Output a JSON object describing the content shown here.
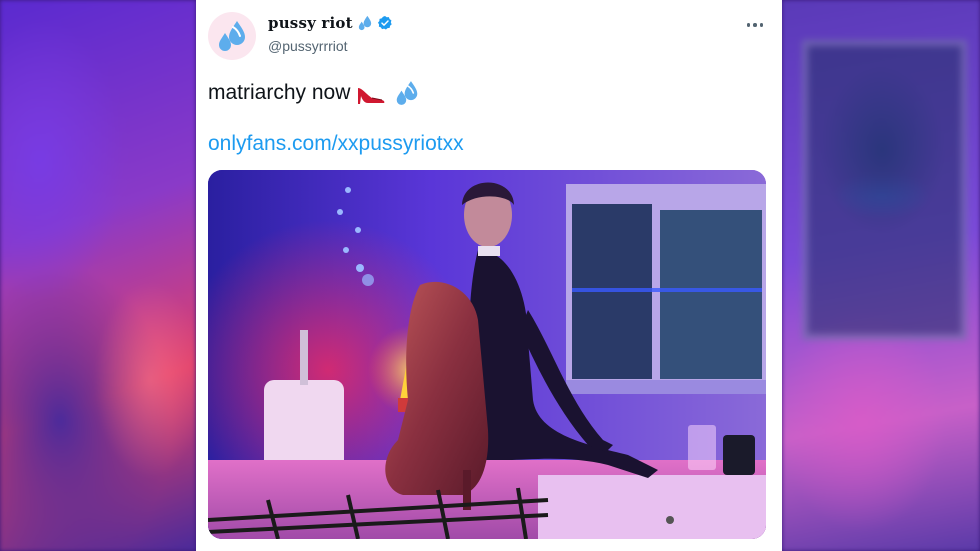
{
  "tweet": {
    "display_name": "pussy riot",
    "handle": "@pussyrrriot",
    "verified": true,
    "text": "matriarchy now",
    "link": "onlyfans.com/xxpussyriotxx",
    "icons": {
      "avatar": "sweat-droplets-icon",
      "name_emoji": "sweat-droplets-icon",
      "verified": "verified-badge-icon",
      "more": "more-options-icon",
      "text_emojis": [
        "high-heel-icon",
        "sweat-droplets-icon"
      ]
    },
    "media": {
      "description_icon": "photo"
    }
  },
  "colors": {
    "link": "#1d9bf0",
    "verified": "#1d9bf0",
    "text": "#0f1419",
    "secondary": "#536471"
  }
}
